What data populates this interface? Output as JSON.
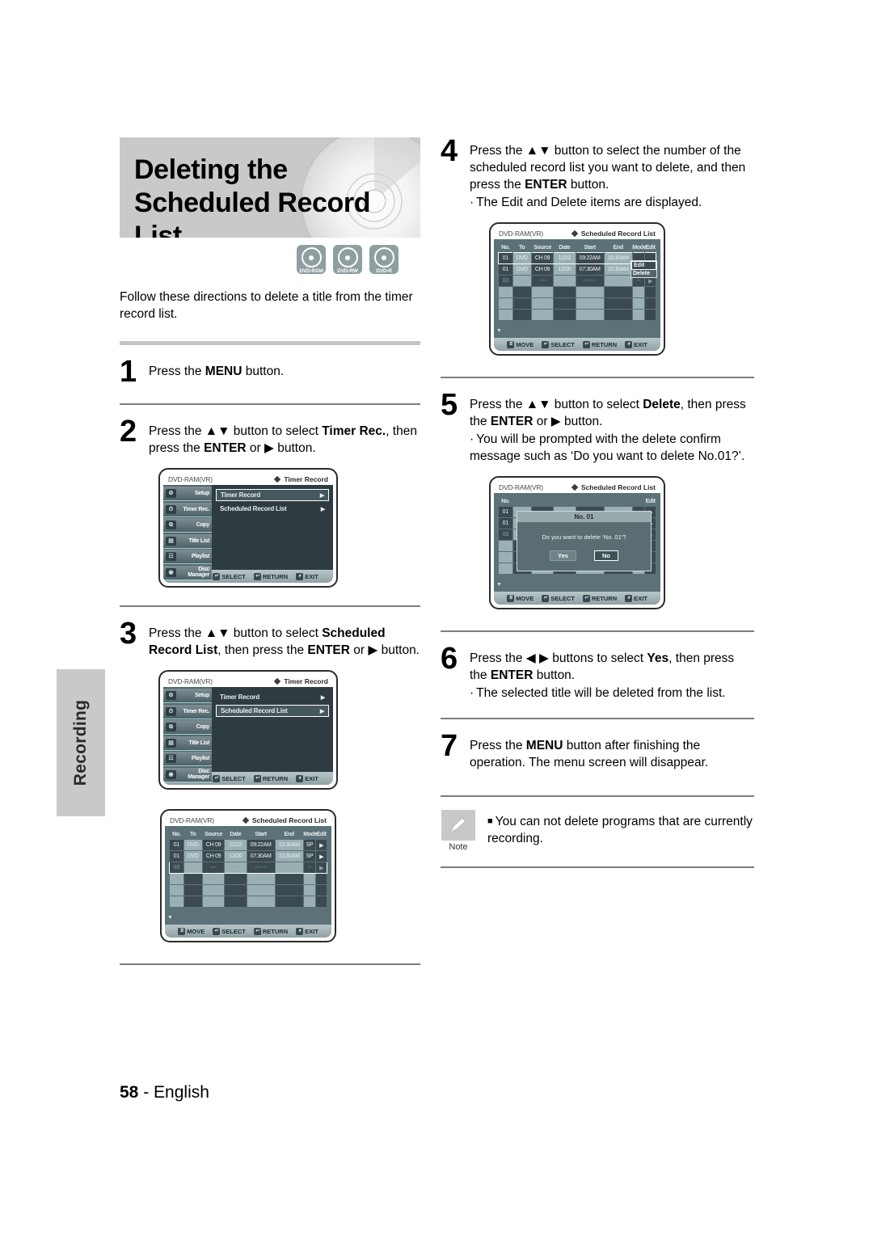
{
  "side_tab": {
    "label": "Recording"
  },
  "banner": {
    "line1": "Deleting the",
    "line2": "Scheduled Record List"
  },
  "disc_badges": [
    {
      "name": "dvd-ram-badge",
      "label": "DVD-RAM"
    },
    {
      "name": "dvd-rw-badge",
      "label": "DVD-RW"
    },
    {
      "name": "dvd-r-badge",
      "label": "DVD-R"
    }
  ],
  "intro": "Follow these directions to delete a title from the timer record list.",
  "steps": {
    "s1": {
      "num": "1",
      "text_1": "Press the ",
      "bold_1": "MENU",
      "text_2": " button."
    },
    "s2": {
      "num": "2",
      "text_1": "Press the ▲▼ button to select ",
      "bold_1": "Timer Rec.",
      "text_2": ", then press the ",
      "bold_2": "ENTER",
      "text_3": " or ▶ button."
    },
    "s3": {
      "num": "3",
      "text_1": "Press the ▲▼ button to select ",
      "bold_1": "Scheduled Record List",
      "text_2": ", then press the ",
      "bold_2": "ENTER",
      "text_3": " or  ▶ button."
    },
    "s4": {
      "num": "4",
      "text_1": "Press the ▲▼ button to select the number of the scheduled record list you want to delete, and then press the ",
      "bold_1": "ENTER",
      "text_2": " button.",
      "bullet": "The Edit and Delete items are displayed."
    },
    "s5": {
      "num": "5",
      "text_1": "Press the ▲▼  button to select ",
      "bold_1": "Delete",
      "text_2": ", then press the ",
      "bold_2": "ENTER",
      "text_3": " or ▶ button.",
      "bullet": "You will be prompted with the delete confirm message such as ‘Do you want to delete No.01?’."
    },
    "s6": {
      "num": "6",
      "text_1": "Press the ◀ ▶ buttons to select ",
      "bold_1": "Yes",
      "text_2": ", then press the ",
      "bold_2": "ENTER",
      "text_3": " button.",
      "bullet": "The selected title will be deleted from the list."
    },
    "s7": {
      "num": "7",
      "text_1": "Press the ",
      "bold_1": "MENU",
      "text_2": " button after finishing the operation. The menu screen will disappear."
    }
  },
  "note": {
    "caption": "Note",
    "bullet": "■",
    "text": "You can not delete programs that are currently recording."
  },
  "osd": {
    "disc_type": "DVD-RAM(VR)",
    "menu_title": "Timer Record",
    "list_title": "Scheduled Record List",
    "sidebar": [
      {
        "label": "Setup",
        "icon": "gear-icon",
        "glyph": "⚙"
      },
      {
        "label": "Timer Rec.",
        "icon": "clock-icon",
        "glyph": "⏱"
      },
      {
        "label": "Copy",
        "icon": "copy-icon",
        "glyph": "⧉"
      },
      {
        "label": "Title List",
        "icon": "film-icon",
        "glyph": "▤"
      },
      {
        "label": "Playlist",
        "icon": "playlist-icon",
        "glyph": "☷"
      },
      {
        "label": "Disc Manager",
        "icon": "disc-icon",
        "glyph": "◉"
      }
    ],
    "menu_rows": [
      {
        "label": "Timer Record",
        "arrow": "▶"
      },
      {
        "label": "Scheduled Record List",
        "arrow": "▶"
      }
    ],
    "table_headers": [
      "No.",
      "To",
      "Source",
      "Date",
      "Start",
      "End",
      "Mode",
      "Edit"
    ],
    "table_rows": [
      {
        "no": "01",
        "to": "DVD",
        "source": "CH 09",
        "date": "11/22",
        "start": "09:22AM",
        "end": "10:30AM",
        "mode": "SP",
        "edit": "▶"
      },
      {
        "no": "01",
        "to": "DVD",
        "source": "CH 09",
        "date": "12/20",
        "start": "07:30AM",
        "end": "10:30AM",
        "mode": "SP",
        "edit": "▶"
      },
      {
        "no": "03",
        "to": "--",
        "source": "----",
        "date": "--/--",
        "start": "--:-- --",
        "end": "--:-- --",
        "mode": "--",
        "edit": "▶"
      }
    ],
    "dropdown": [
      {
        "label": "Edit"
      },
      {
        "label": "Delete"
      }
    ],
    "dialog": {
      "title": "No. 01",
      "message": "Do you want to delete ‘No. 01’?",
      "yes": "Yes",
      "no": "No"
    },
    "footer": [
      {
        "label": "MOVE",
        "icon": "updown-icon",
        "glyph": "⇅"
      },
      {
        "label": "SELECT",
        "icon": "enter-icon",
        "glyph": "↵"
      },
      {
        "label": "RETURN",
        "icon": "return-icon",
        "glyph": "↩"
      },
      {
        "label": "EXIT",
        "icon": "exit-icon",
        "glyph": "⏸"
      }
    ],
    "scroll_glyph": "▼"
  },
  "page_footer": {
    "number": "58",
    "dash": "-",
    "language": "English"
  },
  "colors": {
    "banner_bg": "#c9c9c9",
    "badge_bg": "#8f9fa1",
    "osd_bg": "#5c7278",
    "rule": "#7d7d7d"
  }
}
